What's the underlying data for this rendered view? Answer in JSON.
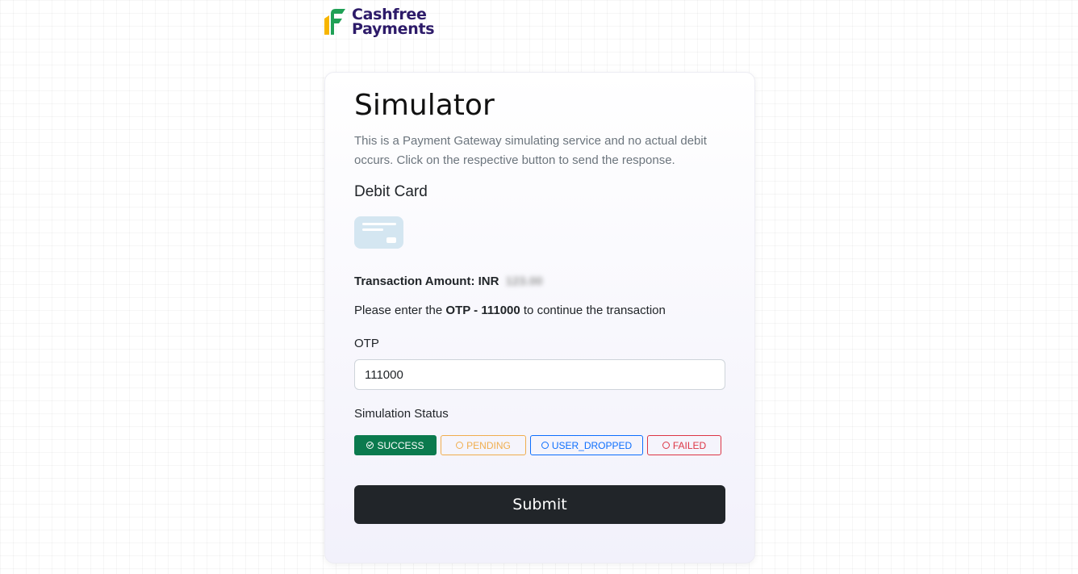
{
  "brand": {
    "line1": "Cashfree",
    "line2": "Payments",
    "colors": {
      "green": "#1fa055",
      "yellow": "#f7b500",
      "text": "#2d1b69"
    }
  },
  "simulator": {
    "title": "Simulator",
    "description": "This is a Payment Gateway simulating service and no actual debit occurs. Click on the respective button to send the response.",
    "method": "Debit Card",
    "method_icon": "credit-card-icon",
    "amount_label": "Transaction Amount: INR",
    "amount_value": "123.00",
    "otp_hint_prefix": "Please enter the ",
    "otp_hint_code": "OTP - 111000",
    "otp_hint_suffix": " to continue the transaction",
    "otp_label": "OTP",
    "otp_value": "111000",
    "status_label": "Simulation Status",
    "statuses": [
      {
        "label": "SUCCESS",
        "selected": true,
        "color": "#0b7a4e"
      },
      {
        "label": "PENDING",
        "selected": false,
        "color": "#f0ad4e"
      },
      {
        "label": "USER_DROPPED",
        "selected": false,
        "color": "#0d6efd"
      },
      {
        "label": "FAILED",
        "selected": false,
        "color": "#dc3545"
      }
    ],
    "submit_label": "Submit"
  }
}
